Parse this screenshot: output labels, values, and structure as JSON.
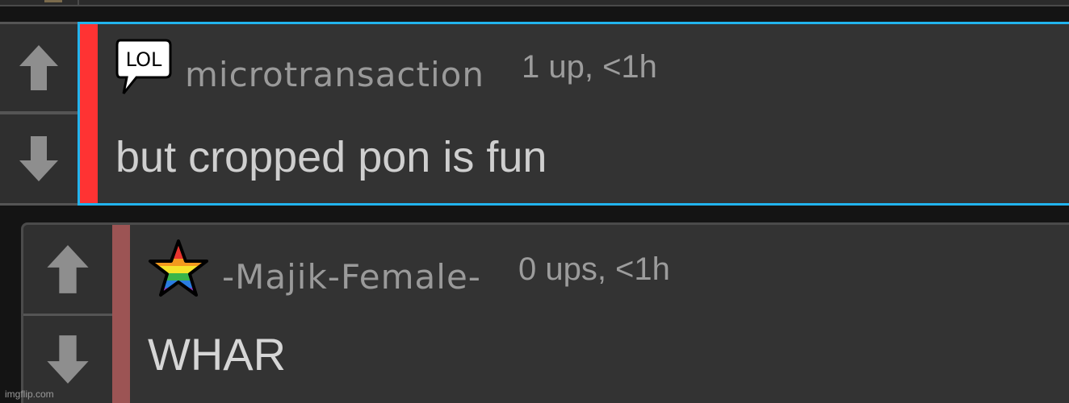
{
  "colors": {
    "background": "#141414",
    "comment_bg": "#333333",
    "highlight_border": "#22b4ee",
    "flag_red": "#ff3333",
    "flag_muted": "#9c5454",
    "text_primary": "#cfcfcf",
    "text_secondary": "#9a9a9a"
  },
  "comments": [
    {
      "badge_icon": "lol-speech-bubble-icon",
      "badge_text": "LOL",
      "username": "microtransaction",
      "score": "1 up, <1h",
      "text": "but cropped pon is fun"
    },
    {
      "badge_icon": "rainbow-star-icon",
      "username": "-Majik-Female-",
      "score": "0 ups, <1h",
      "text": "WHAR"
    }
  ],
  "watermark": "imgflip.com"
}
